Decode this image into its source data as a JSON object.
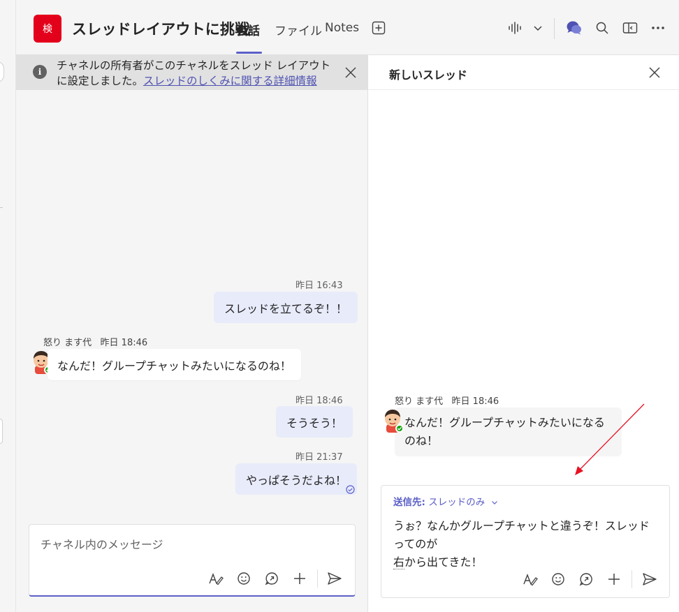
{
  "header": {
    "team_avatar_char": "検",
    "team_avatar_color": "#e3001b",
    "channel_title": "スレッドレイアウトに挑戦",
    "tabs": [
      {
        "label": "会話",
        "active": true
      },
      {
        "label": "ファイル",
        "active": false
      },
      {
        "label": "Notes",
        "active": false
      }
    ],
    "icons": [
      "add-tab-icon",
      "audio-call-icon",
      "chevron-down-icon",
      "chat-bubbles-icon",
      "search-icon",
      "side-panel-icon",
      "more-icon"
    ]
  },
  "banner": {
    "text": "チャネルの所有者がこのチャネルをスレッド レイアウトに設定しました。",
    "link": "スレッドのしくみに関する詳細情報"
  },
  "conversation": {
    "msg1": {
      "time": "昨日 16:43",
      "text": "スレッドを立てるぞ！！"
    },
    "msg2": {
      "sender": "怒り ます代",
      "time": "昨日 18:46",
      "text": "なんだ！グループチャットみたいになるのね！"
    },
    "msg3": {
      "time": "昨日 18:46",
      "text": "そうそう！"
    },
    "msg4": {
      "time": "昨日 21:37",
      "text": "やっぱそうだよね！"
    }
  },
  "composer_left": {
    "placeholder": "チャネル内のメッセージ"
  },
  "thread_panel": {
    "title": "新しいスレッド",
    "message": {
      "sender": "怒り ます代",
      "time": "昨日 18:46",
      "text": "なんだ！グループチャットみたいになるのね！"
    },
    "composer": {
      "send_to_label": "送信先:",
      "send_to_value": "スレッドのみ",
      "draft_line1": "うぉ？なんかグループチャットと違うぞ！スレッドってのが",
      "draft_line2_underlined": "右",
      "draft_line2_rest": "から出てきた！"
    }
  },
  "colors": {
    "accent": "#5b5fc7",
    "my_bubble": "#e8ebfa",
    "presence": "#13a10e",
    "annotation_arrow": "#e81123"
  }
}
